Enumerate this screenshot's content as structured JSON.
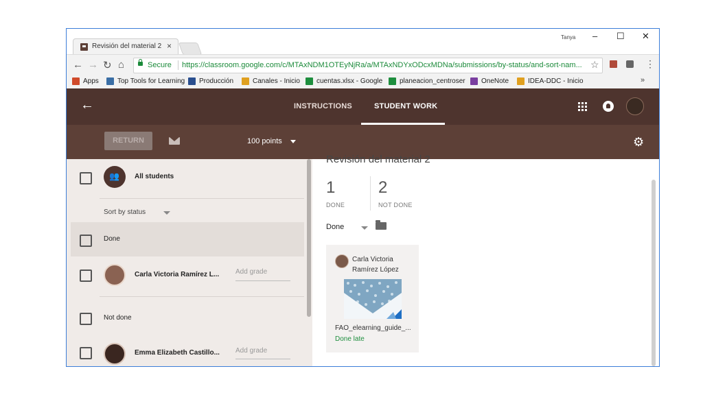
{
  "browser": {
    "tab_title": "Revisión del material 2",
    "tab_close": "×",
    "user": "Tanya",
    "window_controls": [
      "–",
      "☐",
      "✕"
    ],
    "secure_label": "Secure",
    "url": "https://classroom.google.com/c/MTAxNDM1OTEyNjRa/a/MTAxNDYxODcxMDNa/submissions/by-status/and-sort-nam...",
    "bookmarks_more": "»",
    "bookmarks": [
      {
        "label": "Apps",
        "icon": "apps-grid-icon",
        "color": "#d04a2a"
      },
      {
        "label": "Top Tools for Learning",
        "icon": "top-tools-icon",
        "color": "#3a6ea5"
      },
      {
        "label": "Producción",
        "icon": "produccion-icon",
        "color": "#2a4f8f"
      },
      {
        "label": "Canales - Inicio",
        "icon": "canales-icon",
        "color": "#e0a020"
      },
      {
        "label": "cuentas.xlsx - Google",
        "icon": "sheets-icon",
        "color": "#1e8e3e"
      },
      {
        "label": "planeacion_centroser",
        "icon": "sheets-icon",
        "color": "#1e8e3e"
      },
      {
        "label": "OneNote",
        "icon": "onenote-icon",
        "color": "#7a3fa0"
      },
      {
        "label": "IDEA-DDC - Inicio",
        "icon": "idea-icon",
        "color": "#e0a020"
      }
    ]
  },
  "header": {
    "tabs": [
      "INSTRUCTIONS",
      "STUDENT WORK"
    ],
    "active_tab": "STUDENT WORK"
  },
  "actions": {
    "return_label": "RETURN",
    "points_label": "100 points"
  },
  "list": {
    "all_students": "All students",
    "sort_label": "Sort by status",
    "done_section": "Done",
    "not_done_section": "Not done",
    "students": [
      {
        "name": "Carla Victoria Ramírez L...",
        "grade_placeholder": "Add grade"
      },
      {
        "name": "Emma Elizabeth Castillo...",
        "grade_placeholder": "Add grade"
      }
    ]
  },
  "assignment": {
    "title": "Revisión del material 2",
    "done_count": "1",
    "done_label": "DONE",
    "not_done_count": "2",
    "not_done_label": "NOT DONE",
    "filter_label": "Done",
    "card": {
      "student_line1": "Carla Victoria",
      "student_line2": "Ramírez López",
      "file_name": "FAO_elearning_guide_...",
      "status": "Done late"
    }
  },
  "colors": {
    "header_dark": "#4e342e",
    "action_bar": "#5d4037",
    "secure_green": "#1b8a3a",
    "done_late_green": "#1e8e3e"
  }
}
